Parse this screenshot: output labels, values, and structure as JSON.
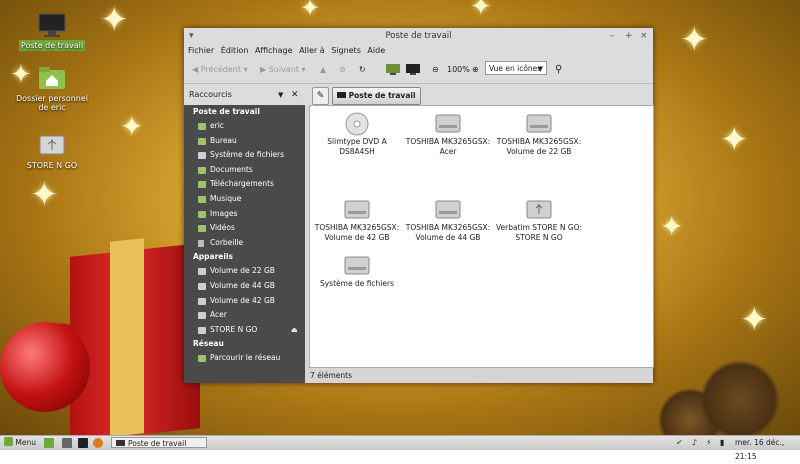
{
  "desktop": {
    "icons": [
      {
        "label": "Poste de travail"
      },
      {
        "label": "Dossier personnel de eric"
      },
      {
        "label": "STORE N GO"
      }
    ]
  },
  "window": {
    "title": "Poste de travail",
    "menu": [
      "Fichier",
      "Édition",
      "Affichage",
      "Aller à",
      "Signets",
      "Aide"
    ],
    "toolbar": {
      "back": "Précédent",
      "forward": "Suivant",
      "zoom": "100%",
      "view_mode": "Vue en icônes"
    },
    "sidebar_title": "Raccourcis",
    "location": "Poste de travail",
    "sidebar": {
      "places_header": "Poste de travail",
      "places": [
        "eric",
        "Bureau",
        "Système de fichiers",
        "Documents",
        "Téléchargements",
        "Musique",
        "Images",
        "Vidéos",
        "Corbeille"
      ],
      "devices_header": "Appareils",
      "devices": [
        "Volume de 22 GB",
        "Volume de 44 GB",
        "Volume de 42 GB",
        "Acer",
        "STORE N GO"
      ],
      "network_header": "Réseau",
      "network": [
        "Parcourir le réseau"
      ]
    },
    "items": [
      {
        "line1": "Slimtype DVD A",
        "line2": "DS8A4SH",
        "type": "optical"
      },
      {
        "line1": "TOSHIBA MK3265GSX:",
        "line2": "Acer",
        "type": "drive"
      },
      {
        "line1": "TOSHIBA MK3265GSX:",
        "line2": "Volume de 22 GB",
        "type": "drive"
      },
      {
        "line1": "TOSHIBA MK3265GSX:",
        "line2": "Volume de 42 GB",
        "type": "drive"
      },
      {
        "line1": "TOSHIBA MK3265GSX:",
        "line2": "Volume de 44 GB",
        "type": "drive"
      },
      {
        "line1": "Verbatim STORE N GO:",
        "line2": "STORE N GO",
        "type": "usb"
      },
      {
        "line1": "Système de fichiers",
        "line2": "",
        "type": "drive"
      }
    ],
    "status": "7 éléments"
  },
  "taskbar": {
    "menu_label": "Menu",
    "window_button": "Poste de travail",
    "clock": "mer. 16 déc., 21:15"
  },
  "colors": {
    "sidebar_bg": "#4a4a4a",
    "selection_green": "#6fa83a",
    "window_chrome": "#dcdcdc"
  }
}
